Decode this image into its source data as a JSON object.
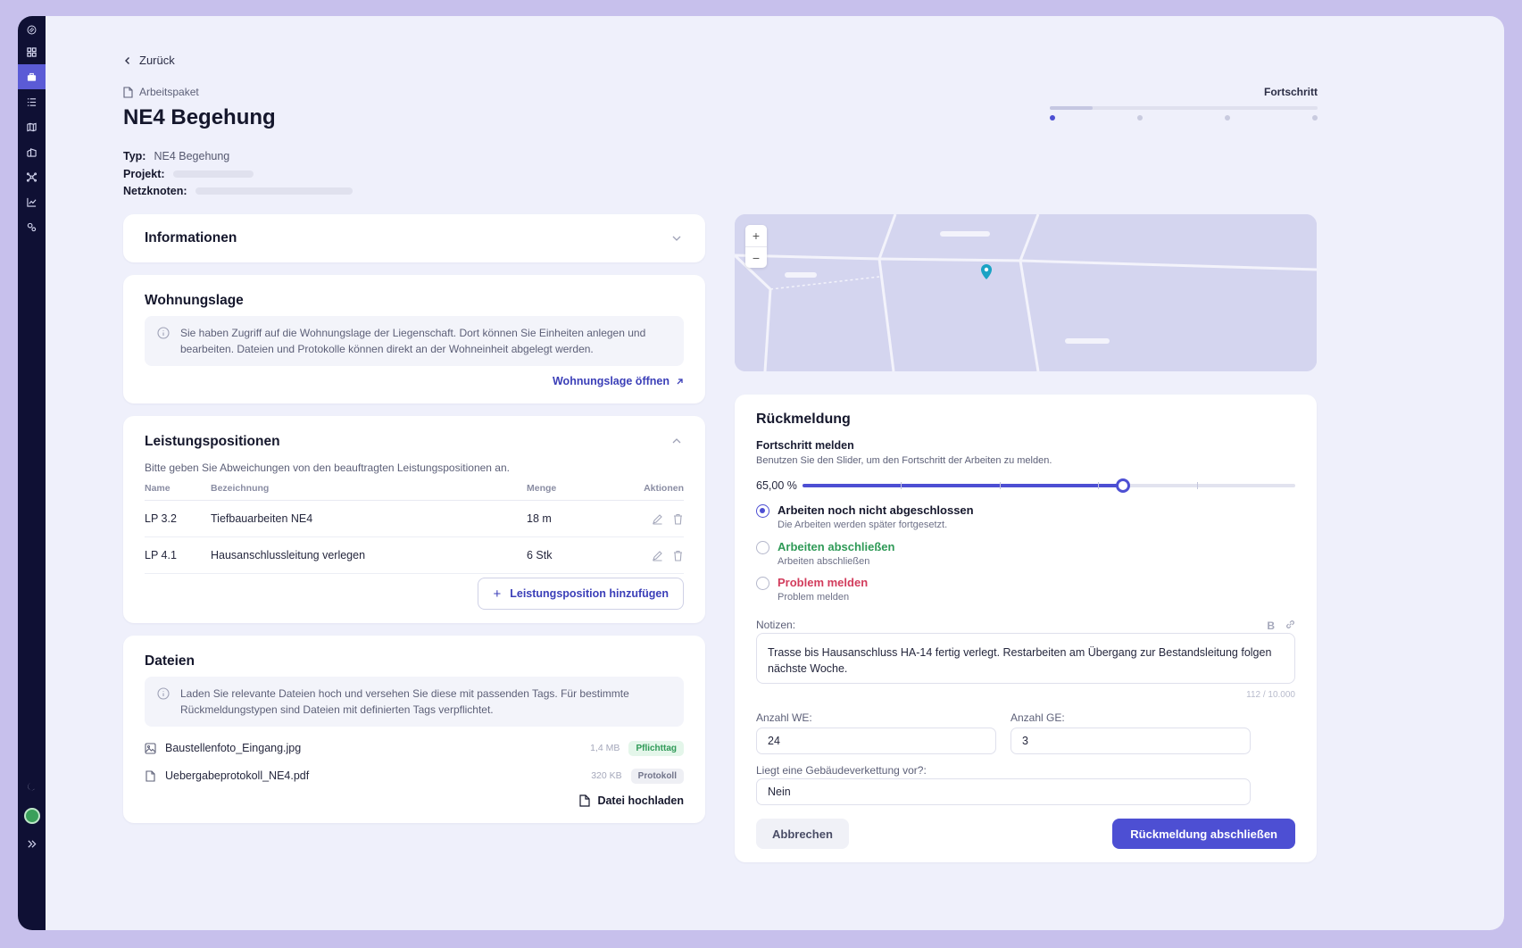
{
  "header": {
    "back_label": "Zurück",
    "kicker": "Arbeitspaket",
    "title": "NE4 Begehung",
    "meta": {
      "typ_label": "Typ:",
      "typ_value": "NE4 Begehung",
      "projekt_label": "Projekt:",
      "netzknoten_label": "Netzknoten:"
    },
    "progress": {
      "label": "Fortschritt",
      "fraction": 0.16,
      "steps": 4,
      "current_step": 1
    }
  },
  "informationen": {
    "title": "Informationen"
  },
  "wohnungslage": {
    "title": "Wohnungslage",
    "info": "Sie haben Zugriff auf die Wohnungslage der Liegenschaft. Dort können Sie Einheiten anlegen und bearbeiten. Dateien und Protokolle können direkt an der Wohneinheit abgelegt werden.",
    "link": "Wohnungslage öffnen"
  },
  "leistungspositionen": {
    "title": "Leistungspositionen",
    "hint": "Bitte geben Sie Abweichungen von den beauftragten Leistungspositionen an.",
    "columns": {
      "name": "Name",
      "bezeichnung": "Bezeichnung",
      "menge": "Menge",
      "aktionen": "Aktionen"
    },
    "rows": [
      {
        "name": "LP 3.2",
        "bezeichnung": "Tiefbauarbeiten NE4",
        "menge": "18 m"
      },
      {
        "name": "LP 4.1",
        "bezeichnung": "Hausanschlussleitung verlegen",
        "menge": "6 Stk"
      }
    ],
    "add_label": "Leistungsposition hinzufügen"
  },
  "dateien": {
    "title": "Dateien",
    "info": "Laden Sie relevante Dateien hoch und versehen Sie diese mit passenden Tags. Für bestimmte Rückmeldungstypen sind Dateien mit definierten Tags verpflichtet.",
    "files": [
      {
        "name": "Baustellenfoto_Eingang.jpg",
        "size": "1,4 MB",
        "tag": "Pflichttag",
        "icon": "image-icon"
      },
      {
        "name": "Uebergabeprotokoll_NE4.pdf",
        "size": "320 KB",
        "tag": "Protokoll",
        "icon": "file-icon"
      }
    ],
    "upload_label": "Datei hochladen"
  },
  "rueckmeldung": {
    "title": "Rückmeldung",
    "progress_title": "Fortschritt melden",
    "progress_hint": "Benutzen Sie den Slider, um den Fortschritt der Arbeiten zu melden.",
    "progress_value": "65,00 %",
    "progress_percent": 65,
    "options": [
      {
        "title": "Arbeiten noch nicht abgeschlossen",
        "sub": "Die Arbeiten werden später fortgesetzt.",
        "color": "#15172c",
        "selected": true
      },
      {
        "title": "Arbeiten abschließen",
        "sub": "Arbeiten abschließen",
        "color": "#2f9a57",
        "selected": false
      },
      {
        "title": "Problem melden",
        "sub": "Problem melden",
        "color": "#d23c5c",
        "selected": false
      }
    ],
    "notes_label": "Notizen:",
    "notes_bold": "B",
    "notes_value": "Trasse bis Hausanschluss HA-14 fertig verlegt. Restarbeiten am Übergang zur Bestandsleitung folgen nächste Woche.",
    "notes_counter": "112 / 10.000",
    "we_label": "Anzahl WE:",
    "we_value": "24",
    "ge_label": "Anzahl GE:",
    "ge_value": "3",
    "verkettung_label": "Liegt eine Gebäudeverkettung vor?:",
    "verkettung_value": "Nein",
    "cancel_label": "Abbrechen",
    "submit_label": "Rückmeldung abschließen"
  },
  "map": {
    "zoom_in": "+",
    "zoom_out": "−"
  },
  "colors": {
    "accent": "#4d4fd3",
    "success": "#2f9a57",
    "danger": "#d23c5c",
    "sidebar": "#0f1034"
  }
}
